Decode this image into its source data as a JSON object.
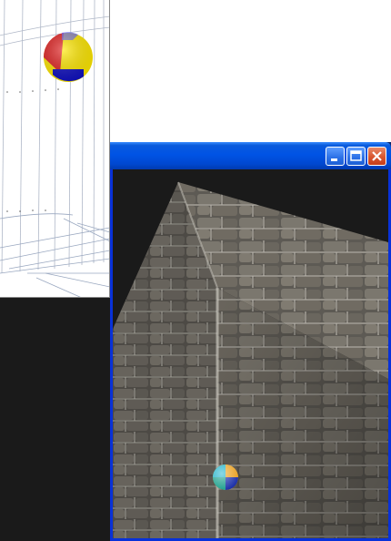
{
  "window": {
    "title": "",
    "buttons": {
      "minimize_icon": "minimize-icon",
      "maximize_icon": "maximize-icon",
      "close_icon": "close-icon"
    }
  },
  "scene": {
    "object": "stone-wall-cube",
    "marker": "multicolor-sphere"
  },
  "wireframe_view": {
    "marker": "multicolor-sphere"
  },
  "colors": {
    "titlebar": "#0053e5",
    "viewport_bg": "#1a1a1a",
    "close_button": "#d8562f",
    "sphere_red": "#e02020",
    "sphere_yellow": "#ffe800",
    "sphere_blue": "#1010c0"
  }
}
